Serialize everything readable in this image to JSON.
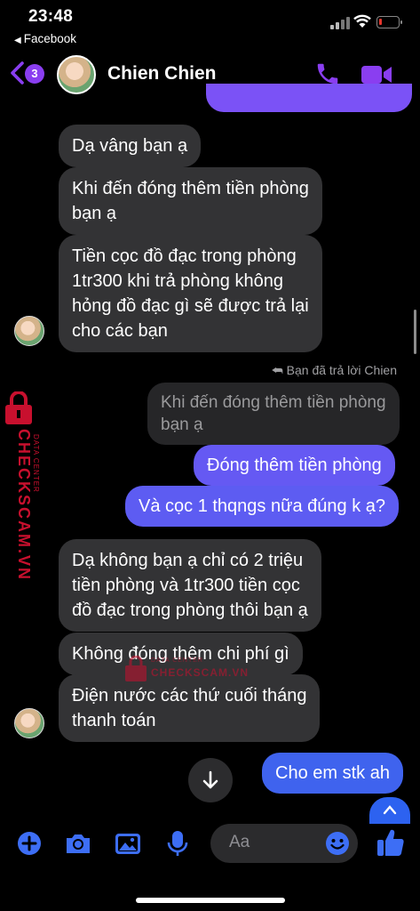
{
  "status_bar": {
    "time": "23:48",
    "back_app_label": "Facebook"
  },
  "header": {
    "badge_count": "3",
    "contact_name": "Chien Chien"
  },
  "messages": [
    {
      "dir": "in",
      "text": "Dạ vâng bạn ạ"
    },
    {
      "dir": "in",
      "lines": [
        "Khi đến đóng thêm tiền phòng",
        "bạn ạ"
      ]
    },
    {
      "dir": "in",
      "lines": [
        "Tiền cọc đồ đạc trong phòng",
        "1tr300 khi trả phòng không",
        "hỏng đồ đạc gì sẽ được trả lại",
        "cho các bạn"
      ]
    },
    {
      "dir": "reply_note",
      "text": "Bạn đã trả lời Chien"
    },
    {
      "dir": "quoted",
      "lines": [
        "Khi đến đóng thêm tiền phòng",
        "bạn ạ"
      ]
    },
    {
      "dir": "out",
      "text": "Đóng thêm tiền phòng"
    },
    {
      "dir": "out",
      "text": "Và cọc 1 thqngs nữa đúng k ạ?"
    },
    {
      "dir": "in",
      "lines": [
        "Dạ không bạn ạ chỉ có 2 triệu",
        "tiền phòng và 1tr300 tiền cọc",
        "đồ đạc trong phòng thôi bạn ạ"
      ]
    },
    {
      "dir": "in",
      "text": "Không đóng thêm chi phí gì"
    },
    {
      "dir": "in",
      "lines": [
        "Điện nước các thứ cuối tháng",
        "thanh toán"
      ]
    },
    {
      "dir": "out",
      "text": "Cho em stk ah"
    }
  ],
  "watermark": {
    "side_top": "DATA CENTER",
    "side_main": "CHECKSCAM.VN",
    "center_top": "DATA CENTER",
    "center_main": "CHECKSCAM.VN"
  },
  "composer": {
    "placeholder": "Aa"
  },
  "colors": {
    "accent": "#8a3ef0",
    "out_bubble_a": "#7a55f5",
    "out_bubble_b": "#3f63ee",
    "in_bubble": "#333335",
    "watermark": "#c8102e"
  },
  "icons": [
    "chevron-left-icon",
    "phone-icon",
    "video-camera-icon",
    "plus-circle-icon",
    "camera-icon",
    "image-icon",
    "microphone-icon",
    "emoji-icon",
    "thumbs-up-icon",
    "arrow-down-icon",
    "reply-arrow-icon",
    "padlock-icon"
  ]
}
